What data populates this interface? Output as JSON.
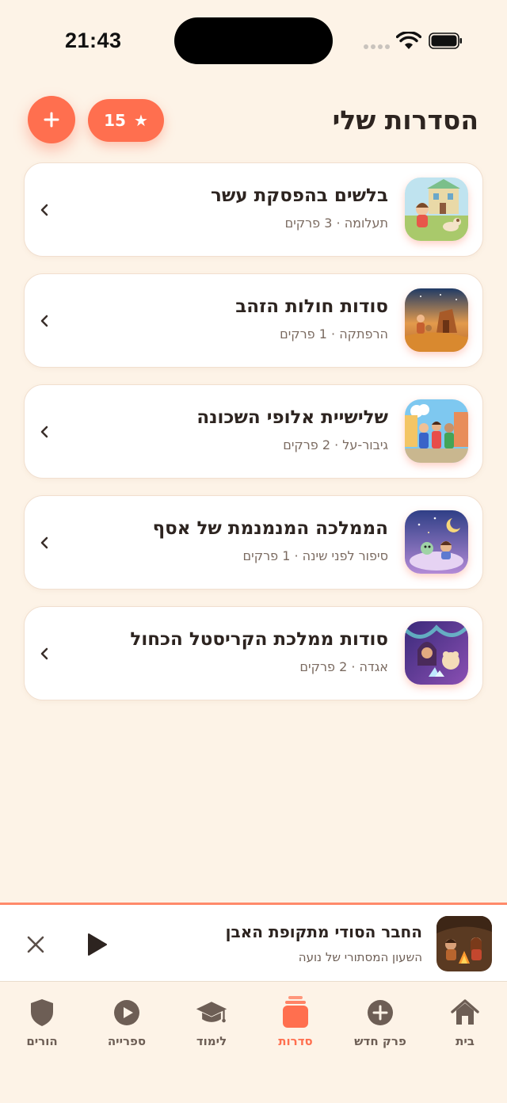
{
  "status_bar": {
    "time": "21:43"
  },
  "header": {
    "title": "הסדרות שלי",
    "stars_count": "15",
    "add_label": "+"
  },
  "series": [
    {
      "title": "בלשים בהפסקת עשר",
      "meta": "תעלומה · 3 פרקים"
    },
    {
      "title": "סודות חולות הזהב",
      "meta": "הרפתקה · 1 פרקים"
    },
    {
      "title": "שלישיית אלופי השכונה",
      "meta": "גיבור-על · 2 פרקים"
    },
    {
      "title": "הממלכה המנמנמת של אסף",
      "meta": "סיפור לפני שינה · 1 פרקים"
    },
    {
      "title": "סודות ממלכת הקריסטל הכחול",
      "meta": "אגדה · 2 פרקים"
    }
  ],
  "player": {
    "title": "החבר הסודי מתקופת האבן",
    "subtitle": "השעון המסתורי של נועה"
  },
  "tabs": [
    {
      "label": "בית",
      "icon": "home-icon"
    },
    {
      "label": "פרק חדש",
      "icon": "plus-circle-icon"
    },
    {
      "label": "סדרות",
      "icon": "stack-icon",
      "active": true
    },
    {
      "label": "לימוד",
      "icon": "graduation-cap-icon"
    },
    {
      "label": "ספרייה",
      "icon": "play-circle-icon"
    },
    {
      "label": "הורים",
      "icon": "shield-icon"
    }
  ],
  "colors": {
    "accent": "#ff6f4f",
    "background": "#fdf3e7",
    "text": "#2d2420",
    "muted": "#6d5e55"
  }
}
